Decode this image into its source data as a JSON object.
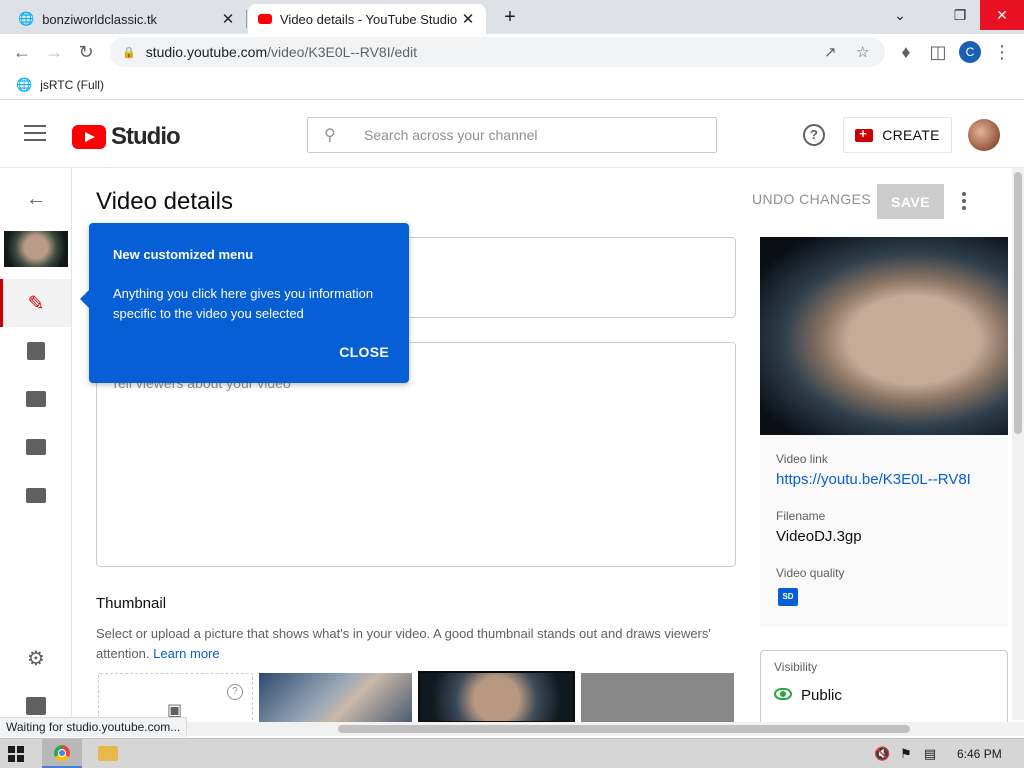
{
  "browser": {
    "tabs": [
      {
        "title": "bonziworldclassic.tk",
        "active": false
      },
      {
        "title": "Video details - YouTube Studio",
        "active": true
      }
    ],
    "url_host": "studio.youtube.com",
    "url_path": "/video/K3E0L--RV8I/edit",
    "profile_initial": "C",
    "bookmark": "jsRTC (Full)",
    "status_text": "Waiting for studio.youtube.com..."
  },
  "header": {
    "logo_text": "Studio",
    "search_placeholder": "Search across your channel",
    "create_label": "CREATE"
  },
  "main": {
    "title": "Video details",
    "undo_label": "UNDO CHANGES",
    "save_label": "SAVE",
    "description_placeholder": "Tell viewers about your video",
    "thumbnail_heading": "Thumbnail",
    "thumbnail_desc": "Select or upload a picture that shows what's in your video. A good thumbnail stands out and draws viewers' attention.",
    "learn_more": "Learn more"
  },
  "tooltip": {
    "title": "New customized menu",
    "body": "Anything you click here gives you information specific to the video you selected",
    "close_label": "CLOSE"
  },
  "side": {
    "video_link_label": "Video link",
    "video_link": "https://youtu.be/K3E0L--RV8I",
    "filename_label": "Filename",
    "filename": "VideoDJ.3gp",
    "quality_label": "Video quality",
    "quality_badge": "SD",
    "visibility_label": "Visibility",
    "visibility_value": "Public"
  },
  "taskbar": {
    "time": "6:46 PM"
  },
  "colors": {
    "accent_blue": "#065fd4",
    "brand_red": "#ff0000",
    "public_green": "#2ba640"
  }
}
